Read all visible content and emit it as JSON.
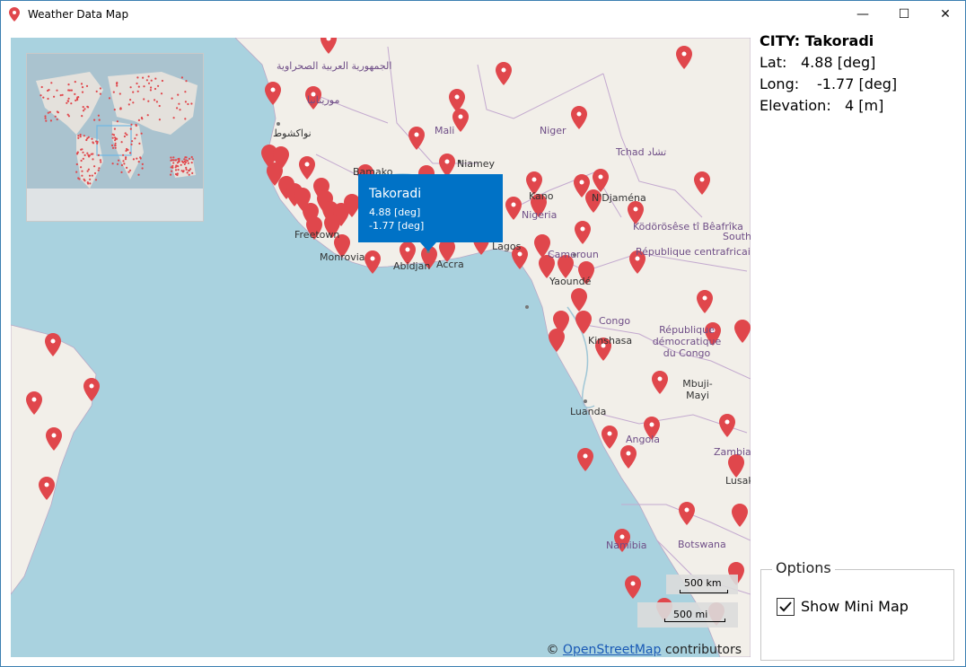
{
  "window": {
    "title": "Weather Data Map",
    "minimize": "—",
    "maximize": "☐",
    "close": "✕"
  },
  "map": {
    "country_labels": [
      "Mali",
      "Niger",
      "Tchad تشاد",
      "Nigeria",
      "Cameroun",
      "Congo",
      "Angola",
      "Zambia",
      "Namibia",
      "Botswana",
      "Ködörösêse tî Bêafrîka",
      "République centrafricaine",
      "République démocratique du Congo",
      "South"
    ],
    "city_labels": [
      "Niamey",
      "Abidjan",
      "Accra",
      "Monrovia",
      "Freetown",
      "Lagos",
      "Yaoundé",
      "Kinshasa",
      "Luanda",
      "Mbuji-Mayi",
      "N'Djaména",
      "Bamako",
      "Kano",
      "Lusaka"
    ],
    "arabic_labels": [
      "الجمهورية العربية الصحراوية",
      "موريتانيا",
      "نواكشوط"
    ],
    "tooltip": {
      "city": "Takoradi",
      "lat": "4.88 [deg]",
      "long": "-1.77 [deg]"
    },
    "scale": {
      "km": "500 km",
      "mi": "500 mi"
    },
    "attribution": {
      "prefix": "©",
      "link": "OpenStreetMap",
      "suffix": "contributors"
    }
  },
  "info": {
    "city_label": "CITY: Takoradi",
    "lat_label": "Lat:",
    "lat_value": "4.88 [deg]",
    "long_label": "Long:",
    "long_value": "-1.77 [deg]",
    "elev_label": "Elevation:",
    "elev_value": "4 [m]"
  },
  "options": {
    "legend": "Options",
    "show_minimap_label": "Show Mini Map",
    "show_minimap_checked": true
  },
  "colors": {
    "marker": "#e0474c",
    "tooltip": "#0072c6",
    "water": "#a9d2df",
    "land": "#f2efe9"
  }
}
